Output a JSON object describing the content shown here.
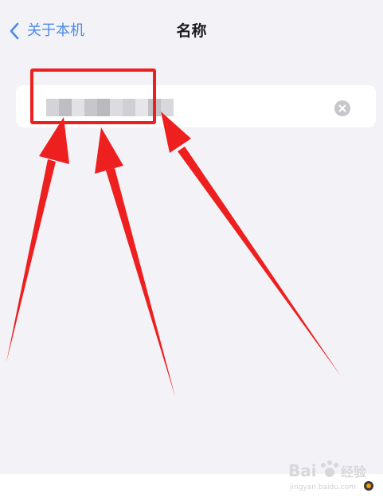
{
  "nav": {
    "back_label": "关于本机",
    "title": "名称"
  },
  "colors": {
    "background": "#f2f2f7",
    "accent": "#4a8be8",
    "annotation_red": "#ee1f1f",
    "field_bg": "#ffffff",
    "clear_button": "#c7c7cc"
  },
  "name_field": {
    "value": ""
  },
  "icons": {
    "back": "chevron-left-icon",
    "clear": "clear-circle-icon"
  }
}
